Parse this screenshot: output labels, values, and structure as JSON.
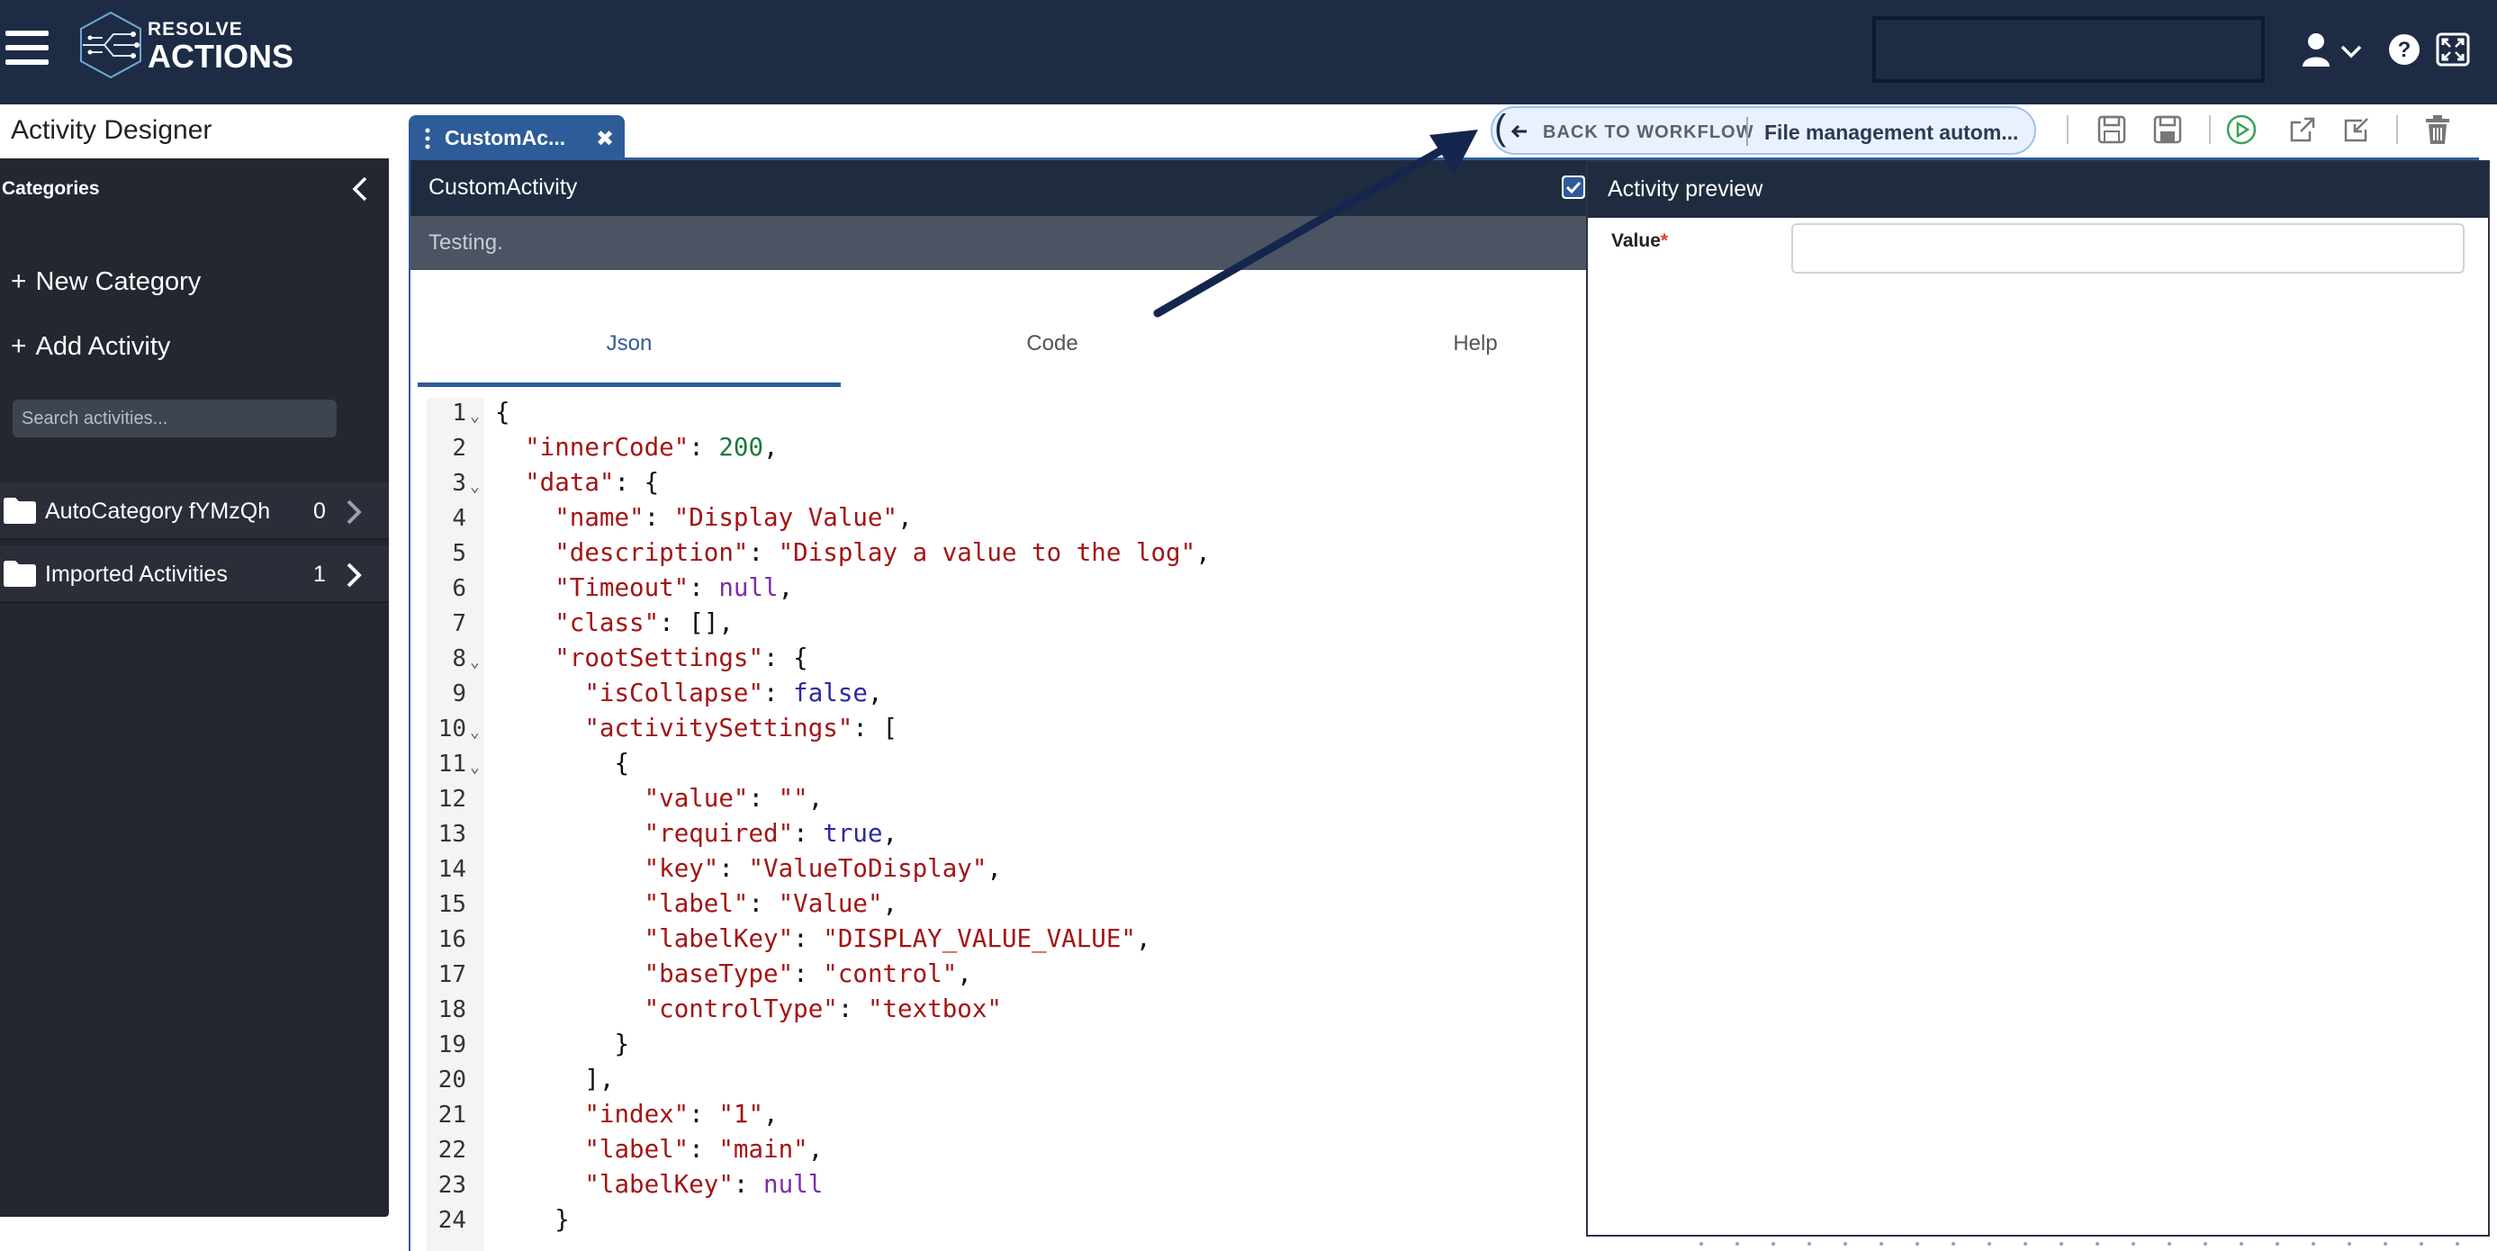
{
  "header": {
    "logo_line1": "RESOLVE",
    "logo_line2": "ACTIONS",
    "colors": {
      "bar": "#1d2c44",
      "accent": "#2e5c99"
    },
    "icons": [
      "menu-icon",
      "user-icon",
      "chevron-down-icon",
      "help-icon",
      "fullscreen-icon"
    ]
  },
  "page": {
    "title": "Activity Designer"
  },
  "sidebar": {
    "title": "Categories",
    "new_category": "New Category",
    "add_activity": "Add Activity",
    "search_placeholder": "Search activities...",
    "categories": [
      {
        "name": "AutoCategory fYMzQh",
        "count": "0"
      },
      {
        "name": "Imported Activities",
        "count": "1"
      }
    ]
  },
  "tab": {
    "title": "CustomAc..."
  },
  "toolbar": {
    "back_label": "BACK TO WORKFLOW",
    "workflow_name": "File management autom...",
    "icons": [
      "save-icon",
      "save-as-icon",
      "run-icon",
      "open-external-icon",
      "export-icon",
      "delete-icon"
    ]
  },
  "editor": {
    "title": "CustomActivity",
    "description": "Testing.",
    "tabs": [
      "Json",
      "Code",
      "Help"
    ],
    "active_tab": "Json",
    "lines": [
      "1",
      "2",
      "3",
      "4",
      "5",
      "6",
      "7",
      "8",
      "9",
      "10",
      "11",
      "12",
      "13",
      "14",
      "15",
      "16",
      "17",
      "18",
      "19",
      "20",
      "21",
      "22",
      "23",
      "24"
    ],
    "code": {
      "l1": "{",
      "l2k": "\"innerCode\"",
      "l2v": "200",
      "l3k": "\"data\"",
      "l3v": "{",
      "l4k": "\"name\"",
      "l4v": "\"Display Value\"",
      "l5k": "\"description\"",
      "l5v": "\"Display a value to the log\"",
      "l6k": "\"Timeout\"",
      "l6v": "null",
      "l7k": "\"class\"",
      "l7v": "[]",
      "l8k": "\"rootSettings\"",
      "l8v": "{",
      "l9k": "\"isCollapse\"",
      "l9v": "false",
      "l10k": "\"activitySettings\"",
      "l10v": "[",
      "l11": "{",
      "l12k": "\"value\"",
      "l12v": "\"\"",
      "l13k": "\"required\"",
      "l13v": "true",
      "l14k": "\"key\"",
      "l14v": "\"ValueToDisplay\"",
      "l15k": "\"label\"",
      "l15v": "\"Value\"",
      "l16k": "\"labelKey\"",
      "l16v": "\"DISPLAY_VALUE_VALUE\"",
      "l17k": "\"baseType\"",
      "l17v": "\"control\"",
      "l18k": "\"controlType\"",
      "l18v": "\"textbox\"",
      "l19": "}",
      "l20": "],",
      "l21k": "\"index\"",
      "l21v": "\"1\"",
      "l22k": "\"label\"",
      "l22v": "\"main\"",
      "l23k": "\"labelKey\"",
      "l23v": "null",
      "l24": "}"
    }
  },
  "preview": {
    "title": "Activity preview",
    "field_label": "Value",
    "required_mark": "*",
    "field_value": ""
  }
}
